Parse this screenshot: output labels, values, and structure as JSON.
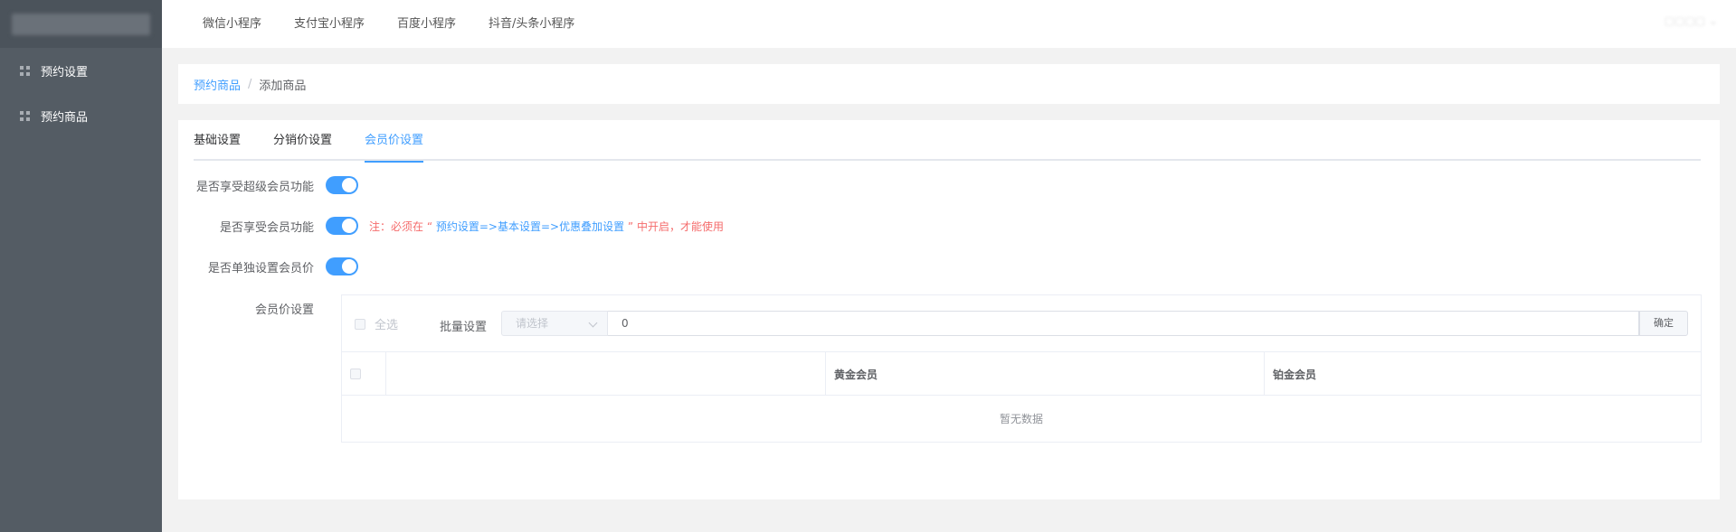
{
  "sidebar": {
    "items": [
      {
        "label": "预约设置"
      },
      {
        "label": "预约商品"
      }
    ]
  },
  "topnav": {
    "links": [
      {
        "label": "微信小程序"
      },
      {
        "label": "支付宝小程序"
      },
      {
        "label": "百度小程序"
      },
      {
        "label": "抖音/头条小程序"
      }
    ]
  },
  "breadcrumb": {
    "parent": "预约商品",
    "separator": "/",
    "current": "添加商品"
  },
  "tabs": [
    {
      "label": "基础设置",
      "active": false
    },
    {
      "label": "分销价设置",
      "active": false
    },
    {
      "label": "会员价设置",
      "active": true
    }
  ],
  "form": {
    "super_member": {
      "label": "是否享受超级会员功能",
      "enabled": true
    },
    "member": {
      "label": "是否享受会员功能",
      "enabled": true,
      "note_prefix": "注：必须在 “ ",
      "note_link": "预约设置=>基本设置=>优惠叠加设置",
      "note_suffix": " ” 中开启，才能使用"
    },
    "separate_price": {
      "label": "是否单独设置会员价",
      "enabled": true
    },
    "member_price": {
      "label": "会员价设置",
      "select_all": "全选",
      "batch_label": "批量设置",
      "select_placeholder": "请选择",
      "input_value": "0",
      "confirm": "确定",
      "columns": [
        "",
        "黄金会员",
        "铂金会员"
      ],
      "empty_text": "暂无数据"
    }
  },
  "colors": {
    "sidebar_bg": "#545c64",
    "accent": "#409eff",
    "warning_text": "#f56c6c"
  }
}
